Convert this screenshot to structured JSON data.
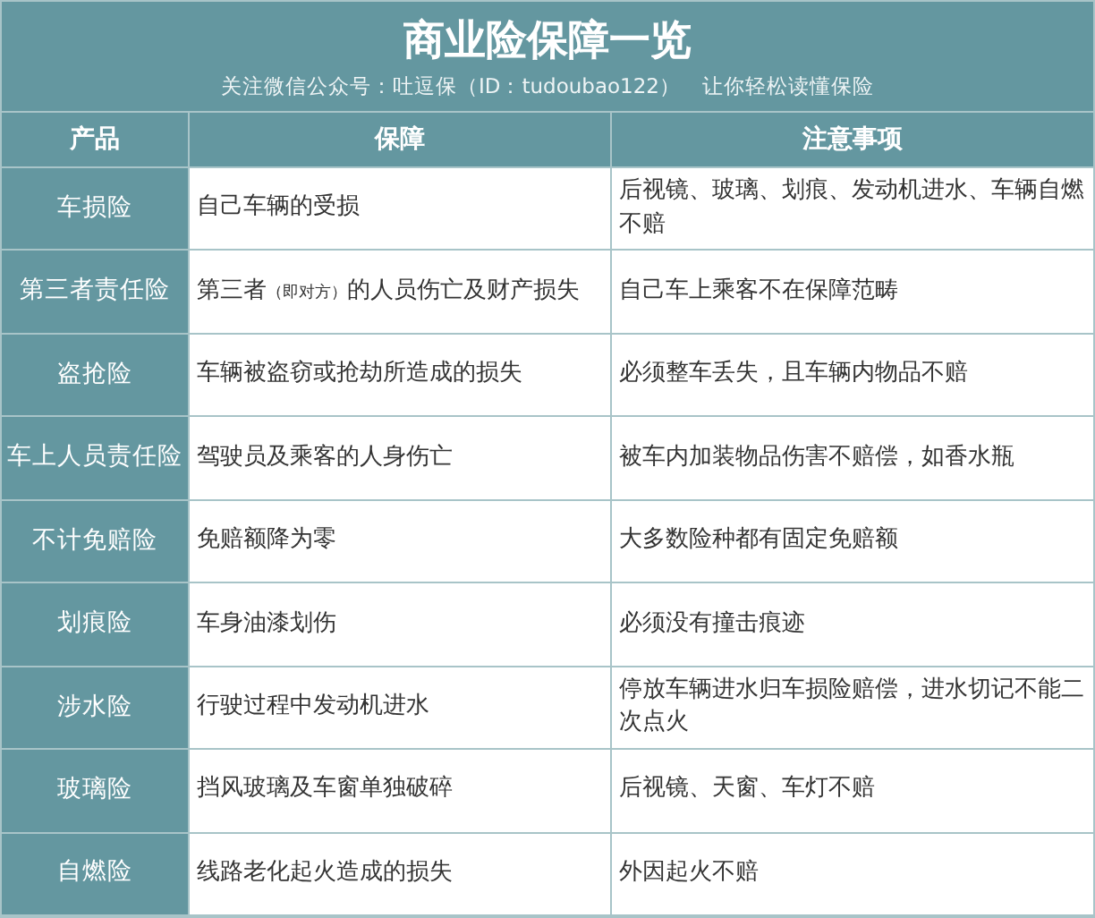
{
  "title": "商业险保障一览",
  "subtitle": "关注微信公众号：吐逗保（ID：tudoubao122）　让你轻松读懂保险",
  "columns": [
    "产品",
    "保障",
    "注意事项"
  ],
  "rows": [
    {
      "product": "车损险",
      "coverage": [
        {
          "text": "自己车辆的受损",
          "small": false
        }
      ],
      "notes": "后视镜、玻璃、划痕、发动机进水、车辆自燃不赔"
    },
    {
      "product": "第三者责任险",
      "coverage": [
        {
          "text": "第三者",
          "small": false
        },
        {
          "text": "（即对方）",
          "small": true
        },
        {
          "text": "的人员伤亡及财产损失",
          "small": false
        }
      ],
      "notes": "自己车上乘客不在保障范畴"
    },
    {
      "product": "盗抢险",
      "coverage": [
        {
          "text": "车辆被盗窃或抢劫所造成的损失",
          "small": false
        }
      ],
      "notes": "必须整车丢失，且车辆内物品不赔"
    },
    {
      "product": "车上人员责任险",
      "coverage": [
        {
          "text": "驾驶员及乘客的人身伤亡",
          "small": false
        }
      ],
      "notes": "被车内加装物品伤害不赔偿，如香水瓶"
    },
    {
      "product": "不计免赔险",
      "coverage": [
        {
          "text": "免赔额降为零",
          "small": false
        }
      ],
      "notes": "大多数险种都有固定免赔额"
    },
    {
      "product": "划痕险",
      "coverage": [
        {
          "text": "车身油漆划伤",
          "small": false
        }
      ],
      "notes": "必须没有撞击痕迹"
    },
    {
      "product": "涉水险",
      "coverage": [
        {
          "text": "行驶过程中发动机进水",
          "small": false
        }
      ],
      "notes": "停放车辆进水归车损险赔偿，进水切记不能二次点火"
    },
    {
      "product": "玻璃险",
      "coverage": [
        {
          "text": "挡风玻璃及车窗单独破碎",
          "small": false
        }
      ],
      "notes": "后视镜、天窗、车灯不赔"
    },
    {
      "product": "自燃险",
      "coverage": [
        {
          "text": "线路老化起火造成的损失",
          "small": false
        }
      ],
      "notes": "外因起火不赔"
    }
  ]
}
